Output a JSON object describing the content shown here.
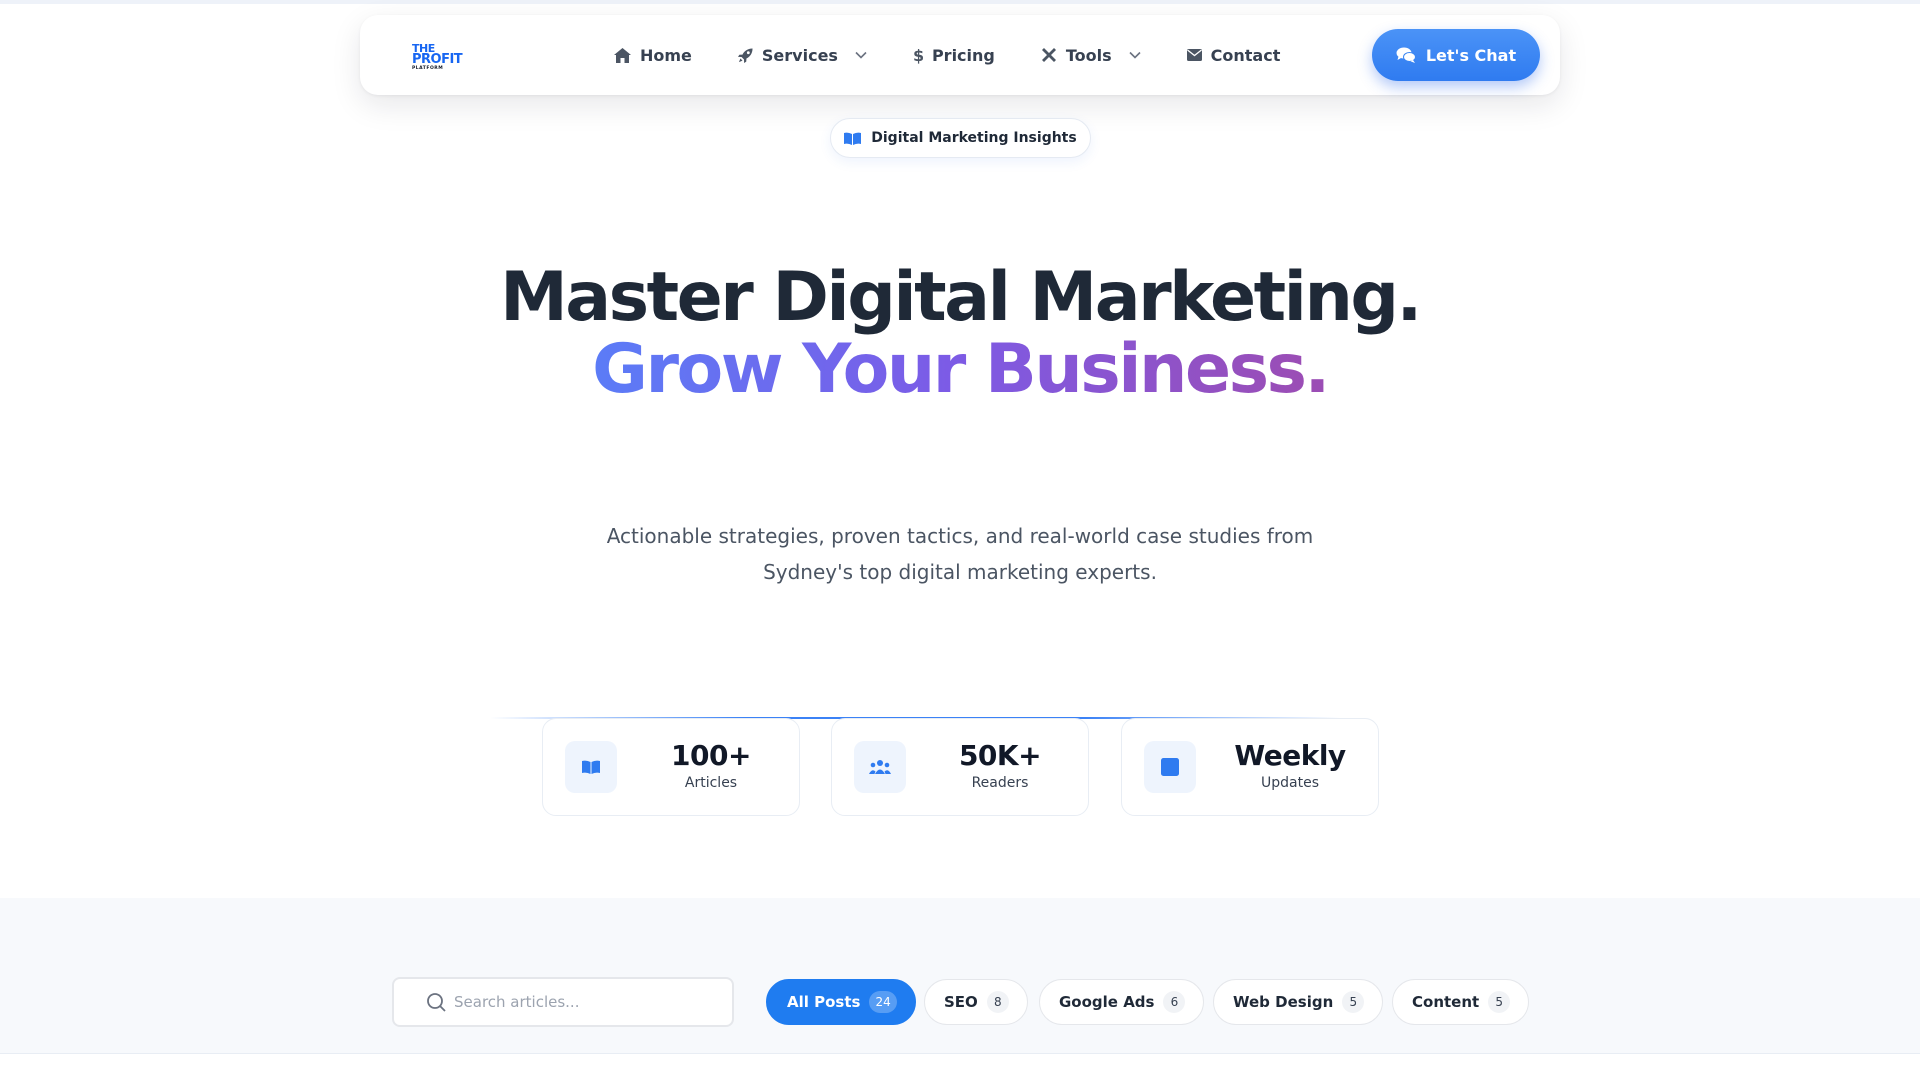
{
  "logo": {
    "line1": "THE",
    "line2": "PROFIT",
    "line3": "PLATFORM"
  },
  "nav": {
    "items": [
      {
        "label": "Home",
        "icon": "home-icon"
      },
      {
        "label": "Services",
        "icon": "rocket-icon",
        "dropdown": true
      },
      {
        "label": "Pricing",
        "icon": "dollar-icon"
      },
      {
        "label": "Tools",
        "icon": "tools-icon",
        "dropdown": true
      },
      {
        "label": "Contact",
        "icon": "envelope-icon"
      }
    ],
    "cta_label": "Let's Chat"
  },
  "badge": {
    "label": "Digital Marketing Insights"
  },
  "hero": {
    "headline_line1": "Master Digital Marketing.",
    "headline_line2": "Grow Your Business",
    "headline_dot": ".",
    "subtitle_line1": "Actionable strategies, proven tactics, and real-world case studies from",
    "subtitle_line2": "Sydney's top digital marketing experts."
  },
  "stats": [
    {
      "value": "100+",
      "label": "Articles",
      "icon": "book-icon"
    },
    {
      "value": "50K+",
      "label": "Readers",
      "icon": "users-icon"
    },
    {
      "value": "Weekly",
      "label": "Updates",
      "icon": "calendar-icon"
    }
  ],
  "filters": {
    "search_placeholder": "Search articles...",
    "categories": [
      {
        "label": "All Posts",
        "count": "24",
        "active": true
      },
      {
        "label": "SEO",
        "count": "8"
      },
      {
        "label": "Google Ads",
        "count": "6"
      },
      {
        "label": "Web Design",
        "count": "5"
      },
      {
        "label": "Content",
        "count": "5"
      }
    ]
  },
  "colors": {
    "accent": "#1f7cf0",
    "heading": "#1f2937",
    "gradient_start": "#5b7cf7",
    "gradient_end": "#9b4db5"
  }
}
